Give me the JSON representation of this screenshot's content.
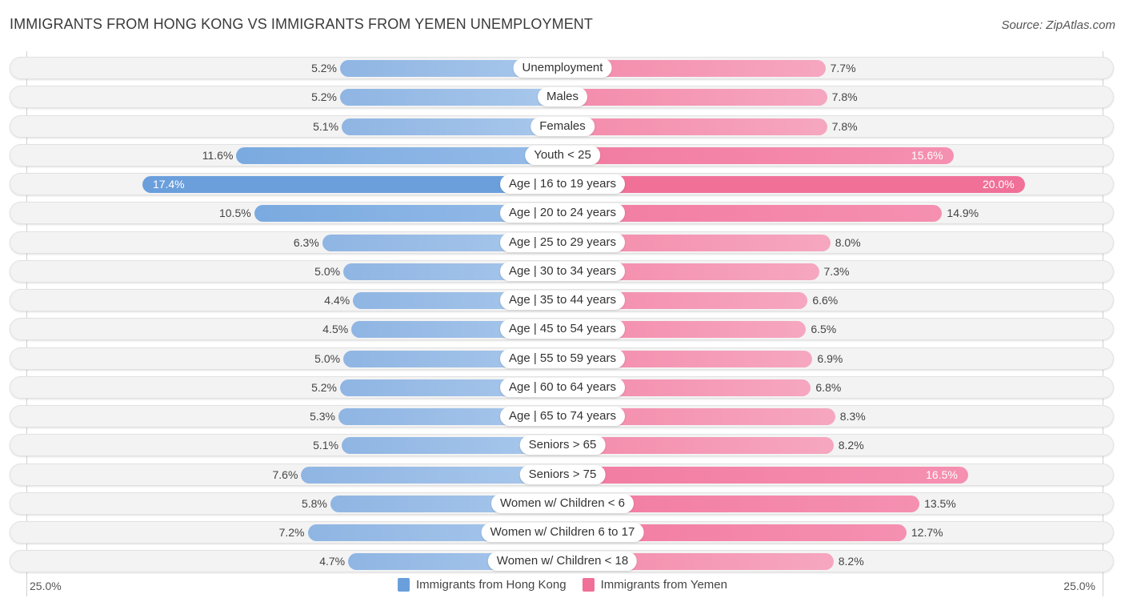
{
  "header": {
    "title": "IMMIGRANTS FROM HONG KONG VS IMMIGRANTS FROM YEMEN UNEMPLOYMENT",
    "source": "Source: ZipAtlas.com"
  },
  "colors": {
    "hong_kong": "#6a9fdc",
    "yemen": "#f07098"
  },
  "chart_data": {
    "type": "bar",
    "orientation": "horizontal-diverging",
    "title": "IMMIGRANTS FROM HONG KONG VS IMMIGRANTS FROM YEMEN UNEMPLOYMENT",
    "xlabel": "",
    "ylabel": "",
    "xlim": [
      0,
      25.0
    ],
    "axis_tick_left": "25.0%",
    "axis_tick_right": "25.0%",
    "legend_position": "bottom",
    "categories": [
      "Unemployment",
      "Males",
      "Females",
      "Youth < 25",
      "Age | 16 to 19 years",
      "Age | 20 to 24 years",
      "Age | 25 to 29 years",
      "Age | 30 to 34 years",
      "Age | 35 to 44 years",
      "Age | 45 to 54 years",
      "Age | 55 to 59 years",
      "Age | 60 to 64 years",
      "Age | 65 to 74 years",
      "Seniors > 65",
      "Seniors > 75",
      "Women w/ Children < 6",
      "Women w/ Children 6 to 17",
      "Women w/ Children < 18"
    ],
    "series": [
      {
        "name": "Immigrants from Hong Kong",
        "side": "left",
        "values": [
          5.2,
          5.2,
          5.1,
          11.6,
          17.4,
          10.5,
          6.3,
          5.0,
          4.4,
          4.5,
          5.0,
          5.2,
          5.3,
          5.1,
          7.6,
          5.8,
          7.2,
          4.7
        ],
        "labels": [
          "5.2%",
          "5.2%",
          "5.1%",
          "11.6%",
          "17.4%",
          "10.5%",
          "6.3%",
          "5.0%",
          "4.4%",
          "4.5%",
          "5.0%",
          "5.2%",
          "5.3%",
          "5.1%",
          "7.6%",
          "5.8%",
          "7.2%",
          "4.7%"
        ]
      },
      {
        "name": "Immigrants from Yemen",
        "side": "right",
        "values": [
          7.7,
          7.8,
          7.8,
          15.6,
          20.0,
          14.9,
          8.0,
          7.3,
          6.6,
          6.5,
          6.9,
          6.8,
          8.3,
          8.2,
          16.5,
          13.5,
          12.7,
          8.2
        ],
        "labels": [
          "7.7%",
          "7.8%",
          "7.8%",
          "15.6%",
          "20.0%",
          "14.9%",
          "8.0%",
          "7.3%",
          "6.6%",
          "6.5%",
          "6.9%",
          "6.8%",
          "8.3%",
          "8.2%",
          "16.5%",
          "13.5%",
          "12.7%",
          "8.2%"
        ]
      }
    ]
  }
}
